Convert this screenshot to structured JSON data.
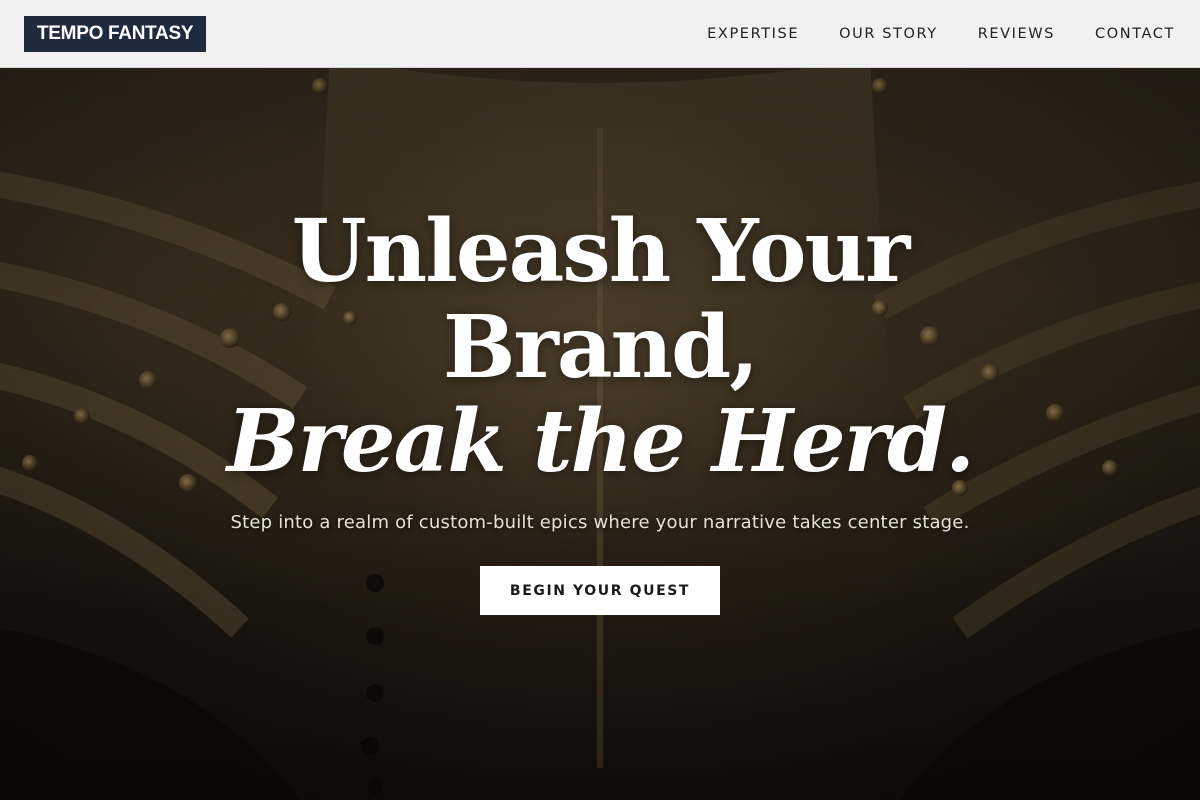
{
  "header": {
    "logo": "TEMPO FANTASY",
    "nav": [
      "EXPERTISE",
      "OUR STORY",
      "REVIEWS",
      "CONTACT"
    ]
  },
  "hero": {
    "headline_line1": "Unleash Your",
    "headline_line2": "Brand,",
    "headline_line3": "Break the Herd.",
    "subtitle": "Step into a realm of custom-built epics where your narrative takes center stage.",
    "cta_label": "BEGIN YOUR QUEST",
    "background_image": "armor-photo"
  },
  "colors": {
    "header_bg": "#f1f1f1",
    "logo_bg": "#1f2a3f",
    "headline": "#ffffff",
    "cta_bg": "#ffffff"
  }
}
